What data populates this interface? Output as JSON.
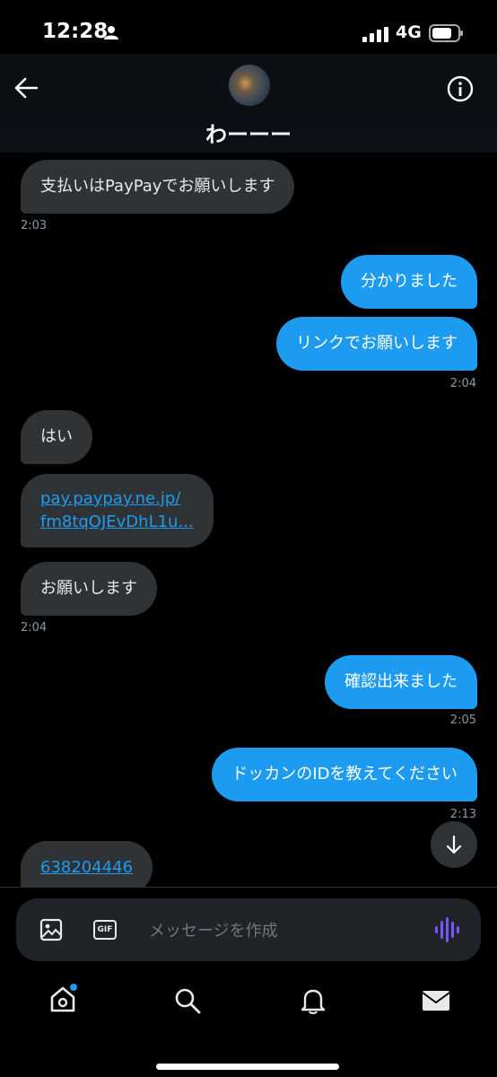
{
  "status": {
    "time": "12:28",
    "network": "4G"
  },
  "header": {
    "name": "わーーー"
  },
  "messages": [
    {
      "side": "in",
      "text": "支払いはPayPayでお願いします",
      "time": "2:03"
    },
    {
      "side": "out",
      "text": "分かりました"
    },
    {
      "side": "out",
      "text": "リンクでお願いします",
      "time": "2:04"
    },
    {
      "side": "in",
      "text": "はい"
    },
    {
      "side": "in",
      "link_line1": "pay.paypay.ne.jp/",
      "link_line2": "fm8tqOJEvDhL1u..."
    },
    {
      "side": "in",
      "text": "お願いします",
      "time": "2:04"
    },
    {
      "side": "out",
      "text": "確認出来ました",
      "time": "2:05"
    },
    {
      "side": "out",
      "text": "ドッカンのIDを教えてください",
      "time": "2:13"
    },
    {
      "side": "in",
      "link": "638204446"
    }
  ],
  "composer": {
    "placeholder": "メッセージを作成",
    "gif_label": "GIF"
  },
  "colors": {
    "accent": "#1d9bf0",
    "incoming": "#2f3336",
    "voice": "#7856ff"
  },
  "icons": [
    "back-icon",
    "info-icon",
    "media-icon",
    "gif-icon",
    "voice-icon",
    "home-icon",
    "search-icon",
    "bell-icon",
    "mail-icon",
    "arrow-down-icon"
  ]
}
